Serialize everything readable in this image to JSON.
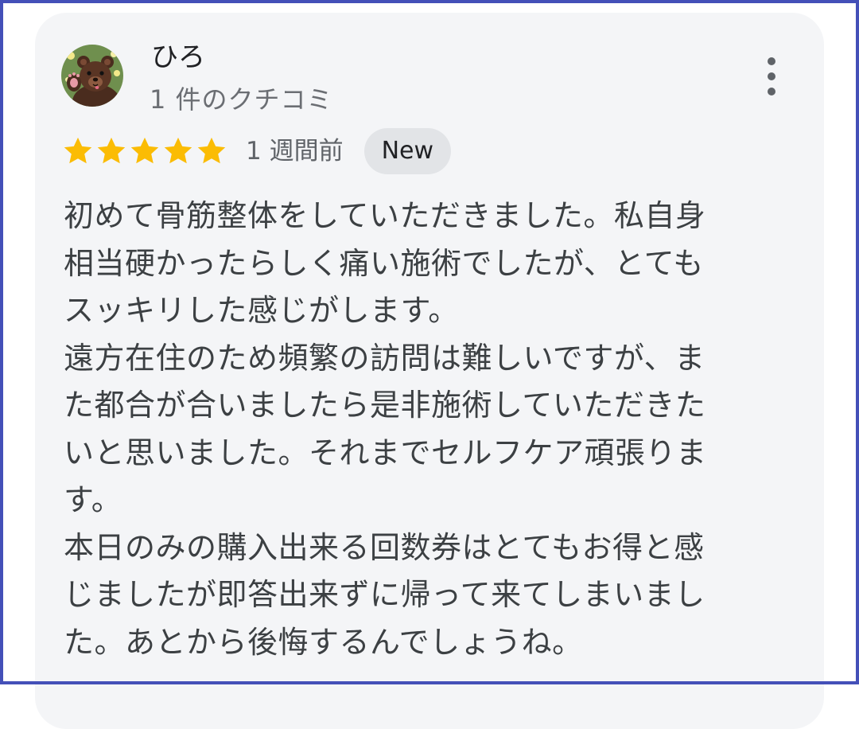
{
  "review": {
    "author_name": "ひろ",
    "author_review_count": "1 件のクチコミ",
    "rating": 5,
    "rating_max": 5,
    "time": "1 週間前",
    "badge": "New",
    "text_lines": [
      "初めて骨筋整体をしていただきました。私自身",
      "相当硬かったらしく痛い施術でしたが、とても",
      "スッキリした感じがします。",
      "遠方在住のため頻繁の訪問は難しいですが、ま",
      "た都合が合いましたら是非施術していただきた",
      "いと思いました。それまでセルフケア頑張りま",
      "す。",
      "本日のみの購入出来る回数券はとてもお得と感",
      "じましたが即答出来ずに帰って来てしまいまし",
      "た。あとから後悔するんでしょうね。"
    ]
  },
  "icons": {
    "avatar": "bear-avatar-icon",
    "more": "more-vert-icon",
    "star": "star-icon"
  },
  "colors": {
    "frame_border": "#4450b8",
    "card_background": "#f4f5f7",
    "star": "#fbbc04",
    "badge_background": "#e2e4e7",
    "body_text": "#3c4043",
    "muted_text": "#5f6368"
  }
}
